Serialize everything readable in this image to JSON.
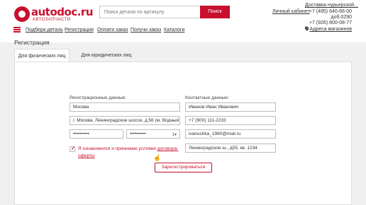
{
  "brand": {
    "name": "autodoc",
    "tld": ".ru",
    "subtitle": "АВТОЗАПЧАСТИ",
    "color": "#c8102e"
  },
  "search": {
    "placeholder": "Поиск детали по артикулу",
    "button": "Поиск"
  },
  "header": {
    "cabinet": "Личный кабинет",
    "delivery": "Доставка нурьерской...",
    "phone1": "+7 (495) 640-66-00",
    "ext": "доб.0290",
    "phone2": "+7 (926) 800-08-77",
    "stores": "Адреса магазинов"
  },
  "nav": [
    "Подбери деталь",
    "Регистрация",
    "Оплати заказ",
    "Получи заказ",
    "Каталоги"
  ],
  "page_title": "Регистрация",
  "tabs": [
    "Для физических лиц",
    "Для юридических лиц"
  ],
  "form": {
    "reg_label": "Регистрационные данные:",
    "contact_label": "Контактные данные:",
    "city": "Москва",
    "store": "г. Москва, Ленинградское шоссе, д.56 (м. Водный",
    "password": "••••••••••",
    "password_confirm": "••••••••••",
    "name": "Иванов Иван Иванович",
    "phone": "+7 (900) 111-2233",
    "email": "ivanushka_1960@mail.ru",
    "address": "Ленинградское ш., д55, кв. 1234",
    "agree_text": "Я ознакомился и принимаю условия ",
    "agree_link": "договора-оферты",
    "submit": "Зарегистрироваться"
  }
}
